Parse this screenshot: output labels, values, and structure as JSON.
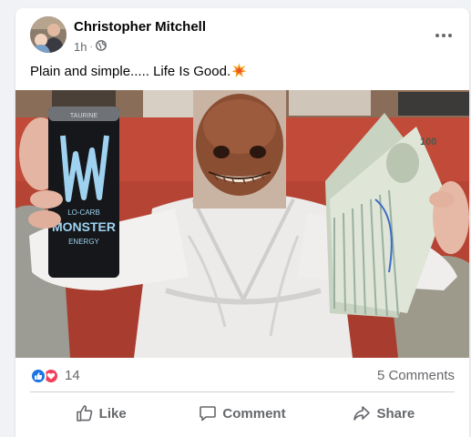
{
  "post": {
    "author": "Christopher Mitchell",
    "time": "1h",
    "privacy_icon": "globe-icon",
    "text": "Plain and simple..... Life Is Good.",
    "text_emoji": "explosion-emoji",
    "photo": {
      "description_icon": "photo",
      "can_brand": "MONSTER",
      "can_top": "TAURINE",
      "can_sub": "LO-CARB",
      "can_bottom": "ENERGY",
      "bill_value": "100"
    }
  },
  "stats": {
    "reaction_icons": [
      "like-reaction-icon",
      "love-reaction-icon"
    ],
    "reaction_count": "14",
    "comments": "5 Comments"
  },
  "actions": {
    "like": "Like",
    "comment": "Comment",
    "share": "Share"
  },
  "colors": {
    "accent": "#1b74e4",
    "love": "#f33e58",
    "secondary_text": "#65676b",
    "divider": "#ced0d4"
  }
}
